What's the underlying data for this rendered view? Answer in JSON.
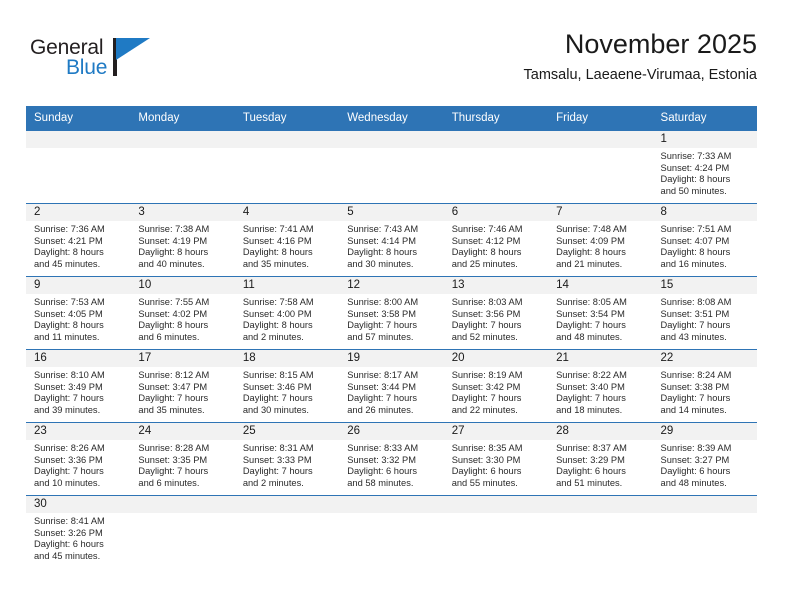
{
  "brand": {
    "name_top": "General",
    "name_bottom": "Blue",
    "accent_color": "#1f7ac4"
  },
  "header": {
    "title": "November 2025",
    "subtitle": "Tamsalu, Laeaene-Virumaa, Estonia"
  },
  "theme": {
    "header_blue": "#2e74b5",
    "daynum_band": "#f2f2f2",
    "text": "#1a1a1a"
  },
  "weekdays": [
    "Sunday",
    "Monday",
    "Tuesday",
    "Wednesday",
    "Thursday",
    "Friday",
    "Saturday"
  ],
  "weeks": [
    [
      {
        "day": "",
        "lines": []
      },
      {
        "day": "",
        "lines": []
      },
      {
        "day": "",
        "lines": []
      },
      {
        "day": "",
        "lines": []
      },
      {
        "day": "",
        "lines": []
      },
      {
        "day": "",
        "lines": []
      },
      {
        "day": "1",
        "lines": [
          "Sunrise: 7:33 AM",
          "Sunset: 4:24 PM",
          "Daylight: 8 hours",
          "and 50 minutes."
        ]
      }
    ],
    [
      {
        "day": "2",
        "lines": [
          "Sunrise: 7:36 AM",
          "Sunset: 4:21 PM",
          "Daylight: 8 hours",
          "and 45 minutes."
        ]
      },
      {
        "day": "3",
        "lines": [
          "Sunrise: 7:38 AM",
          "Sunset: 4:19 PM",
          "Daylight: 8 hours",
          "and 40 minutes."
        ]
      },
      {
        "day": "4",
        "lines": [
          "Sunrise: 7:41 AM",
          "Sunset: 4:16 PM",
          "Daylight: 8 hours",
          "and 35 minutes."
        ]
      },
      {
        "day": "5",
        "lines": [
          "Sunrise: 7:43 AM",
          "Sunset: 4:14 PM",
          "Daylight: 8 hours",
          "and 30 minutes."
        ]
      },
      {
        "day": "6",
        "lines": [
          "Sunrise: 7:46 AM",
          "Sunset: 4:12 PM",
          "Daylight: 8 hours",
          "and 25 minutes."
        ]
      },
      {
        "day": "7",
        "lines": [
          "Sunrise: 7:48 AM",
          "Sunset: 4:09 PM",
          "Daylight: 8 hours",
          "and 21 minutes."
        ]
      },
      {
        "day": "8",
        "lines": [
          "Sunrise: 7:51 AM",
          "Sunset: 4:07 PM",
          "Daylight: 8 hours",
          "and 16 minutes."
        ]
      }
    ],
    [
      {
        "day": "9",
        "lines": [
          "Sunrise: 7:53 AM",
          "Sunset: 4:05 PM",
          "Daylight: 8 hours",
          "and 11 minutes."
        ]
      },
      {
        "day": "10",
        "lines": [
          "Sunrise: 7:55 AM",
          "Sunset: 4:02 PM",
          "Daylight: 8 hours",
          "and 6 minutes."
        ]
      },
      {
        "day": "11",
        "lines": [
          "Sunrise: 7:58 AM",
          "Sunset: 4:00 PM",
          "Daylight: 8 hours",
          "and 2 minutes."
        ]
      },
      {
        "day": "12",
        "lines": [
          "Sunrise: 8:00 AM",
          "Sunset: 3:58 PM",
          "Daylight: 7 hours",
          "and 57 minutes."
        ]
      },
      {
        "day": "13",
        "lines": [
          "Sunrise: 8:03 AM",
          "Sunset: 3:56 PM",
          "Daylight: 7 hours",
          "and 52 minutes."
        ]
      },
      {
        "day": "14",
        "lines": [
          "Sunrise: 8:05 AM",
          "Sunset: 3:54 PM",
          "Daylight: 7 hours",
          "and 48 minutes."
        ]
      },
      {
        "day": "15",
        "lines": [
          "Sunrise: 8:08 AM",
          "Sunset: 3:51 PM",
          "Daylight: 7 hours",
          "and 43 minutes."
        ]
      }
    ],
    [
      {
        "day": "16",
        "lines": [
          "Sunrise: 8:10 AM",
          "Sunset: 3:49 PM",
          "Daylight: 7 hours",
          "and 39 minutes."
        ]
      },
      {
        "day": "17",
        "lines": [
          "Sunrise: 8:12 AM",
          "Sunset: 3:47 PM",
          "Daylight: 7 hours",
          "and 35 minutes."
        ]
      },
      {
        "day": "18",
        "lines": [
          "Sunrise: 8:15 AM",
          "Sunset: 3:46 PM",
          "Daylight: 7 hours",
          "and 30 minutes."
        ]
      },
      {
        "day": "19",
        "lines": [
          "Sunrise: 8:17 AM",
          "Sunset: 3:44 PM",
          "Daylight: 7 hours",
          "and 26 minutes."
        ]
      },
      {
        "day": "20",
        "lines": [
          "Sunrise: 8:19 AM",
          "Sunset: 3:42 PM",
          "Daylight: 7 hours",
          "and 22 minutes."
        ]
      },
      {
        "day": "21",
        "lines": [
          "Sunrise: 8:22 AM",
          "Sunset: 3:40 PM",
          "Daylight: 7 hours",
          "and 18 minutes."
        ]
      },
      {
        "day": "22",
        "lines": [
          "Sunrise: 8:24 AM",
          "Sunset: 3:38 PM",
          "Daylight: 7 hours",
          "and 14 minutes."
        ]
      }
    ],
    [
      {
        "day": "23",
        "lines": [
          "Sunrise: 8:26 AM",
          "Sunset: 3:36 PM",
          "Daylight: 7 hours",
          "and 10 minutes."
        ]
      },
      {
        "day": "24",
        "lines": [
          "Sunrise: 8:28 AM",
          "Sunset: 3:35 PM",
          "Daylight: 7 hours",
          "and 6 minutes."
        ]
      },
      {
        "day": "25",
        "lines": [
          "Sunrise: 8:31 AM",
          "Sunset: 3:33 PM",
          "Daylight: 7 hours",
          "and 2 minutes."
        ]
      },
      {
        "day": "26",
        "lines": [
          "Sunrise: 8:33 AM",
          "Sunset: 3:32 PM",
          "Daylight: 6 hours",
          "and 58 minutes."
        ]
      },
      {
        "day": "27",
        "lines": [
          "Sunrise: 8:35 AM",
          "Sunset: 3:30 PM",
          "Daylight: 6 hours",
          "and 55 minutes."
        ]
      },
      {
        "day": "28",
        "lines": [
          "Sunrise: 8:37 AM",
          "Sunset: 3:29 PM",
          "Daylight: 6 hours",
          "and 51 minutes."
        ]
      },
      {
        "day": "29",
        "lines": [
          "Sunrise: 8:39 AM",
          "Sunset: 3:27 PM",
          "Daylight: 6 hours",
          "and 48 minutes."
        ]
      }
    ],
    [
      {
        "day": "30",
        "lines": [
          "Sunrise: 8:41 AM",
          "Sunset: 3:26 PM",
          "Daylight: 6 hours",
          "and 45 minutes."
        ]
      },
      {
        "day": "",
        "lines": []
      },
      {
        "day": "",
        "lines": []
      },
      {
        "day": "",
        "lines": []
      },
      {
        "day": "",
        "lines": []
      },
      {
        "day": "",
        "lines": []
      },
      {
        "day": "",
        "lines": []
      }
    ]
  ]
}
